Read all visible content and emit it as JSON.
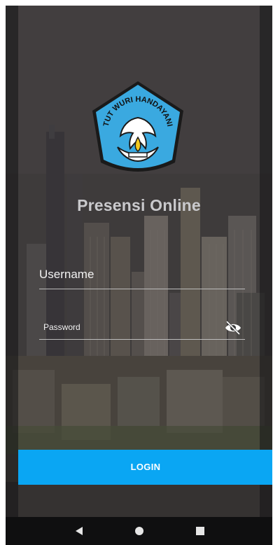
{
  "app": {
    "title": "Presensi Online",
    "logo_text": "TUT WURI HANDAYANI"
  },
  "form": {
    "username_placeholder": "Username",
    "password_placeholder": "Password",
    "login_label": "LOGIN"
  },
  "icons": {
    "password_toggle": "eye-off-icon",
    "nav_back": "back-triangle-icon",
    "nav_home": "home-circle-icon",
    "nav_recents": "recents-square-icon"
  },
  "colors": {
    "accent": "#0aa6f3",
    "logo_blue": "#3aa9e0",
    "logo_yellow": "#f4c91e",
    "navbar": "#0f0f10"
  }
}
